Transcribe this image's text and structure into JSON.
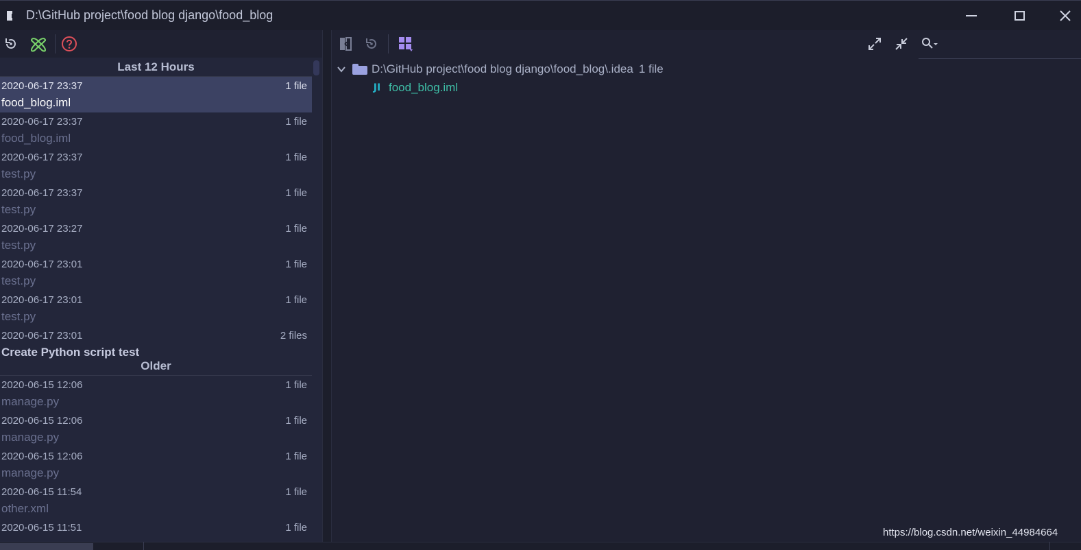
{
  "window": {
    "title": "D:\\GitHub project\\food blog django\\food_blog",
    "minimize_icon": "minimize-icon",
    "maximize_icon": "maximize-icon",
    "close_icon": "close-icon"
  },
  "left_toolbar": {
    "icons": [
      "revert-icon",
      "show-diff-icon",
      "help-icon"
    ]
  },
  "right_toolbar": {
    "icons": [
      "compare-icon",
      "revert-changes-icon",
      "group-by-icon",
      "expand-all-icon",
      "collapse-all-icon",
      "search-icon"
    ]
  },
  "history": {
    "groups": [
      {
        "label": "Last 12 Hours",
        "entries": [
          {
            "time": "2020-06-17 23:37",
            "count": "1 file",
            "name": "food_blog.iml",
            "selected": true
          },
          {
            "time": "2020-06-17 23:37",
            "count": "1 file",
            "name": "food_blog.iml"
          },
          {
            "time": "2020-06-17 23:37",
            "count": "1 file",
            "name": "test.py"
          },
          {
            "time": "2020-06-17 23:37",
            "count": "1 file",
            "name": "test.py"
          },
          {
            "time": "2020-06-17 23:27",
            "count": "1 file",
            "name": "test.py"
          },
          {
            "time": "2020-06-17 23:01",
            "count": "1 file",
            "name": "test.py"
          },
          {
            "time": "2020-06-17 23:01",
            "count": "1 file",
            "name": "test.py"
          },
          {
            "time": "2020-06-17 23:01",
            "count": "2 files",
            "name": "Create Python script test",
            "strong": true
          }
        ]
      },
      {
        "label": "Older",
        "entries": [
          {
            "time": "2020-06-15 12:06",
            "count": "1 file",
            "name": "manage.py"
          },
          {
            "time": "2020-06-15 12:06",
            "count": "1 file",
            "name": "manage.py"
          },
          {
            "time": "2020-06-15 12:06",
            "count": "1 file",
            "name": "manage.py"
          },
          {
            "time": "2020-06-15 11:54",
            "count": "1 file",
            "name": "other.xml"
          },
          {
            "time": "2020-06-15 11:51",
            "count": "1 file",
            "name": ""
          }
        ]
      }
    ]
  },
  "tree": {
    "folder_path": "D:\\GitHub project\\food blog django\\food_blog\\.idea",
    "folder_count": "1 file",
    "file_name": "food_blog.iml",
    "file_icon_label": "JI"
  },
  "watermark": "https://blog.csdn.net/weixin_44984664"
}
